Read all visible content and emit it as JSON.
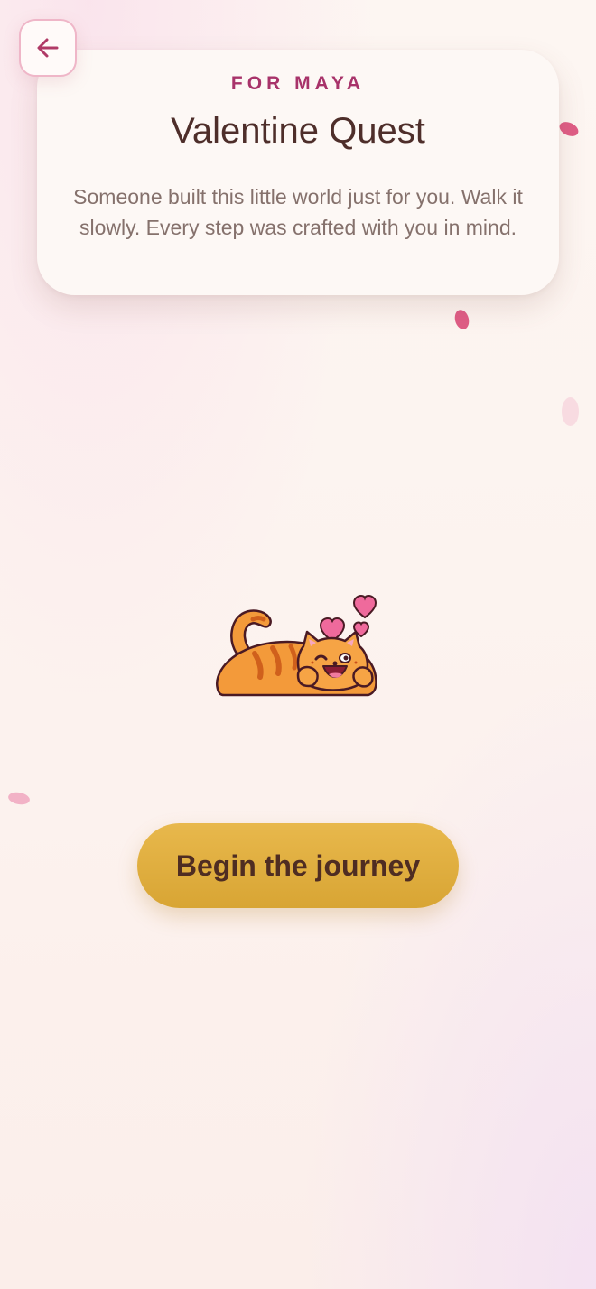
{
  "intro": {
    "eyebrow": "FOR MAYA",
    "title": "Valentine Quest",
    "description": "Someone built this little world just for you. Walk it slowly. Every step was crafted with you in mind."
  },
  "actions": {
    "begin_label": "Begin the journey"
  },
  "icons": {
    "back": "arrow-left-icon",
    "mascot": "cat-with-hearts-icon",
    "petal": "petal-icon"
  },
  "colors": {
    "accent_pink": "#a8336a",
    "title_brown": "#4e2e2a",
    "button_gold": "#e0ae40",
    "petal_pink": "#e0608a"
  }
}
